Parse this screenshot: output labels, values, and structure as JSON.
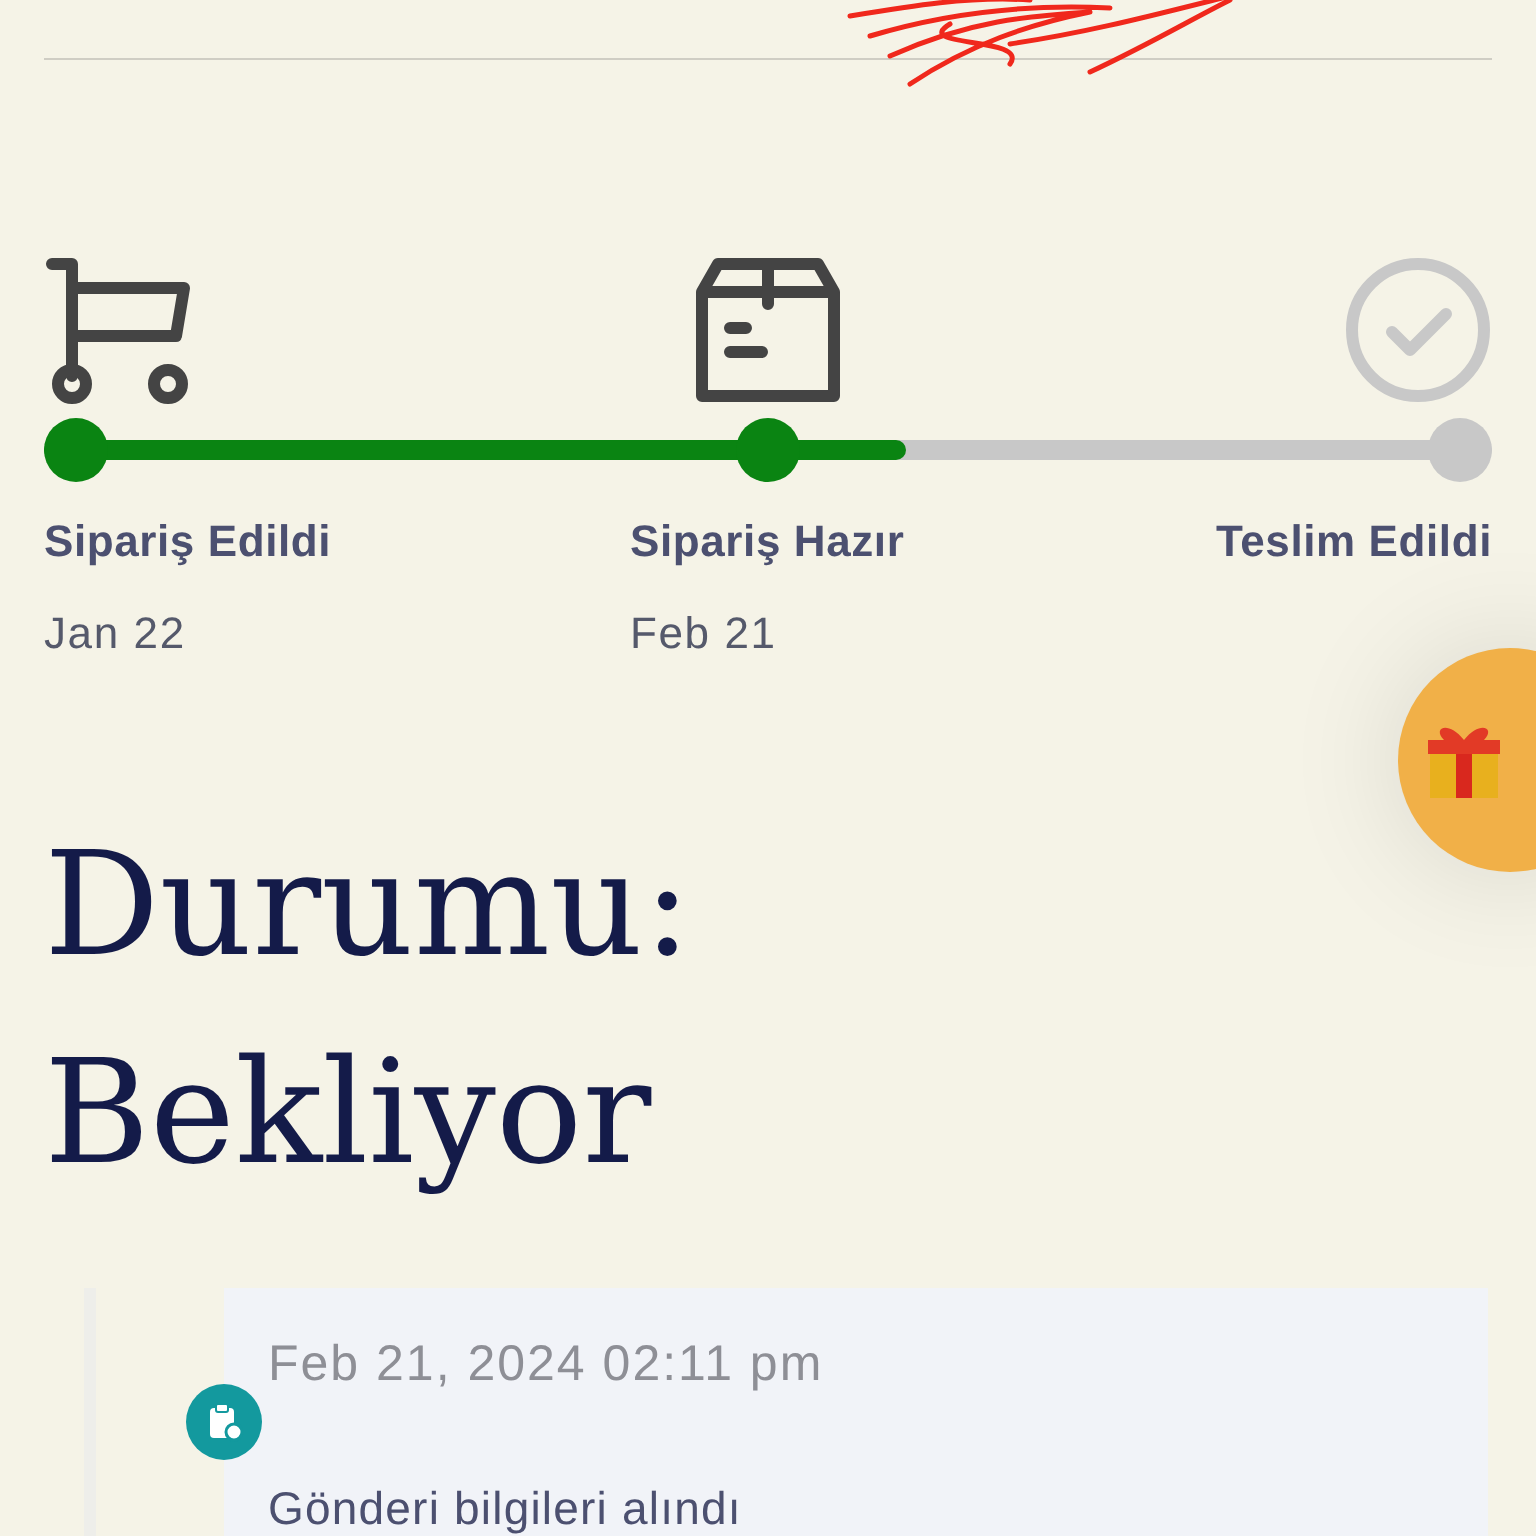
{
  "progress": {
    "level": 0.595
  },
  "steps": [
    {
      "kind": "cart",
      "label": "Sipariş Edildi",
      "date": "Jan 22",
      "done": true
    },
    {
      "kind": "box",
      "label": "Sipariş Hazır",
      "date": "Feb 21",
      "done": true
    },
    {
      "kind": "check",
      "label": "Teslim Edildi",
      "done": false
    }
  ],
  "status": {
    "heading": "Durumu: Bekliyor"
  },
  "timeline": [
    {
      "time": "Feb 21, 2024 02:11 pm",
      "text": "Gönderi bilgileri alındı"
    }
  ]
}
